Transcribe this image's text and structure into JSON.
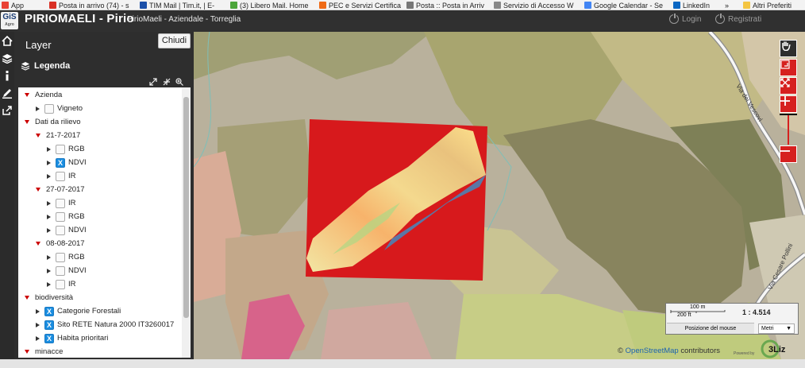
{
  "bookmarks": [
    {
      "label": "App",
      "icon": "apps-icon",
      "color": "#e94235"
    },
    {
      "label": "Posta in arrivo (74) - s",
      "icon": "gmail-icon",
      "color": "#d93025"
    },
    {
      "label": "TIM Mail | Tim.it, | E-",
      "icon": "mail-icon",
      "color": "#1b4fa8"
    },
    {
      "label": "(3) Libero Mail. Home",
      "icon": "libero-icon",
      "color": "#4ca53a"
    },
    {
      "label": "PEC e Servizi Certifica",
      "icon": "star-icon",
      "color": "#ef6a15"
    },
    {
      "label": "Posta :: Posta in Arriv",
      "icon": "roundcube-icon",
      "color": "#777777"
    },
    {
      "label": "Servizio di Accesso W",
      "icon": "page-icon",
      "color": "#888888"
    },
    {
      "label": "Google Calendar - Se",
      "icon": "calendar-icon",
      "color": "#4285f4"
    },
    {
      "label": "LinkedIn",
      "icon": "linkedin-icon",
      "color": "#0a66c2"
    },
    {
      "label": "»",
      "icon": "",
      "color": ""
    },
    {
      "label": "Altri Preferiti",
      "icon": "folder-icon",
      "color": "#f4c542"
    }
  ],
  "header": {
    "logo_text": "GiS",
    "logo_sub": "Agro",
    "title": "PIRIOMAELI - Pirio",
    "subtitle": "PirioMaeli - Aziendale - Torreglia",
    "login": "Login",
    "register": "Registrati"
  },
  "panel": {
    "title": "Layer",
    "close": "Chiudi",
    "legend": "Legenda"
  },
  "tree": [
    {
      "label": "Azienda",
      "level": 0,
      "expanded": true,
      "checkbox": false
    },
    {
      "label": "Vigneto",
      "level": 1,
      "expanded": false,
      "checkbox": true,
      "checked": false
    },
    {
      "label": "Dati da rilievo",
      "level": 0,
      "expanded": true,
      "checkbox": false
    },
    {
      "label": "21-7-2017",
      "level": 1,
      "expanded": true,
      "checkbox": false
    },
    {
      "label": "RGB",
      "level": 2,
      "expanded": false,
      "checkbox": true,
      "checked": false
    },
    {
      "label": "NDVI",
      "level": 2,
      "expanded": false,
      "checkbox": true,
      "checked": true
    },
    {
      "label": "IR",
      "level": 2,
      "expanded": false,
      "checkbox": true,
      "checked": false
    },
    {
      "label": "27-07-2017",
      "level": 1,
      "expanded": true,
      "checkbox": false
    },
    {
      "label": "IR",
      "level": 2,
      "expanded": false,
      "checkbox": true,
      "checked": false
    },
    {
      "label": "RGB",
      "level": 2,
      "expanded": false,
      "checkbox": true,
      "checked": false
    },
    {
      "label": "NDVI",
      "level": 2,
      "expanded": false,
      "checkbox": true,
      "checked": false
    },
    {
      "label": "08-08-2017",
      "level": 1,
      "expanded": true,
      "checkbox": false
    },
    {
      "label": "RGB",
      "level": 2,
      "expanded": false,
      "checkbox": true,
      "checked": false
    },
    {
      "label": "NDVI",
      "level": 2,
      "expanded": false,
      "checkbox": true,
      "checked": false
    },
    {
      "label": "IR",
      "level": 2,
      "expanded": false,
      "checkbox": true,
      "checked": false
    },
    {
      "label": "biodiversità",
      "level": 0,
      "expanded": true,
      "checkbox": false
    },
    {
      "label": "Categorie Forestali",
      "level": 1,
      "expanded": false,
      "checkbox": true,
      "checked": true
    },
    {
      "label": "Sito RETE Natura 2000 IT3260017",
      "level": 1,
      "expanded": false,
      "checkbox": true,
      "checked": true
    },
    {
      "label": "Habita prioritari",
      "level": 1,
      "expanded": false,
      "checkbox": true,
      "checked": true
    },
    {
      "label": "minacce",
      "level": 0,
      "expanded": true,
      "checkbox": false
    }
  ],
  "map": {
    "street_1": "Via dei Vescovi",
    "street_2": "Via Cesare Pollini",
    "scale_m": "100 m",
    "scale_ft": "200 ft",
    "scale_ratio": "1 : 4.514",
    "mouse_label": "Posizione del mouse",
    "units_value": "Metri",
    "attribution_prefix": "©",
    "attribution_link": "OpenStreetMap",
    "attribution_suffix": "contributors",
    "powered_label": "Powered by",
    "powered_brand": "3Liz",
    "accent_red": "#d6201f"
  }
}
